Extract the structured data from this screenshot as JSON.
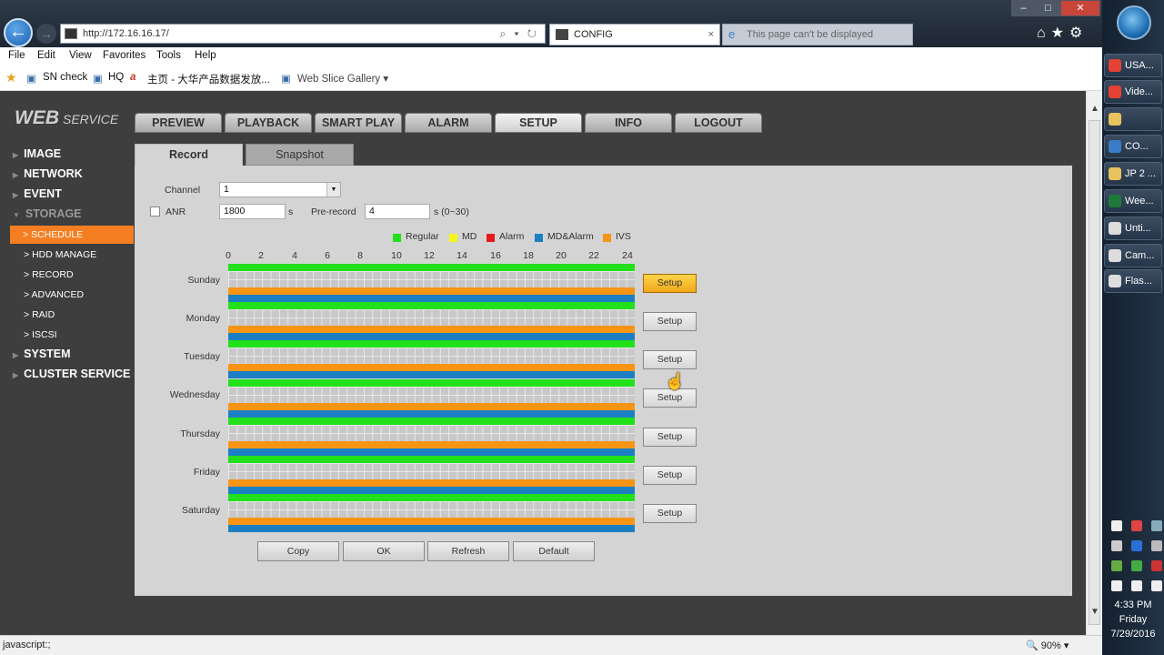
{
  "browser": {
    "url": "http://172.16.16.17/",
    "address_controls": "⌕ ▾ ↻",
    "tabs": [
      {
        "label": "CONFIG",
        "close": "×"
      },
      {
        "label": "This page can't be displayed"
      }
    ],
    "window_controls": {
      "minimize": "–",
      "maximize": "□",
      "close": "✕"
    },
    "menu": [
      "File",
      "Edit",
      "View",
      "Favorites",
      "Tools",
      "Help"
    ],
    "favorites": [
      "SN check",
      "HQ",
      "主页 - 大华产品数据发放...",
      "Web Slice Gallery ▾"
    ],
    "status_text": "javascript:;",
    "zoom": "🔍 90% ▾"
  },
  "app": {
    "logo_main": "WEB",
    "logo_sub": "SERVICE",
    "nav_tabs": [
      "PREVIEW",
      "PLAYBACK",
      "SMART PLAY",
      "ALARM",
      "SETUP",
      "INFO",
      "LOGOUT"
    ],
    "active_nav": "SETUP",
    "sidebar": {
      "items": [
        "IMAGE",
        "NETWORK",
        "EVENT",
        "STORAGE",
        "SYSTEM",
        "CLUSTER SERVICE"
      ],
      "storage_sub": [
        "SCHEDULE",
        "HDD MANAGE",
        "RECORD",
        "ADVANCED",
        "RAID",
        "ISCSI"
      ],
      "active_sub": "SCHEDULE"
    },
    "sub_tabs": [
      "Record",
      "Snapshot"
    ],
    "form": {
      "channel_label": "Channel",
      "channel_value": "1",
      "anr_label": "ANR",
      "anr_value": "1800",
      "anr_unit": "s",
      "prerecord_label": "Pre-record",
      "prerecord_value": "4",
      "prerecord_unit": "s (0~30)"
    },
    "legend": [
      {
        "label": "Regular",
        "color": "#22e01a"
      },
      {
        "label": "MD",
        "color": "#f5f51c"
      },
      {
        "label": "Alarm",
        "color": "#e31b1b"
      },
      {
        "label": "MD&Alarm",
        "color": "#1c7fc4"
      },
      {
        "label": "IVS",
        "color": "#f79414"
      }
    ],
    "hours": [
      "0",
      "2",
      "4",
      "6",
      "8",
      "10",
      "12",
      "14",
      "16",
      "18",
      "20",
      "22",
      "24"
    ],
    "days": [
      "Sunday",
      "Monday",
      "Tuesday",
      "Wednesday",
      "Thursday",
      "Friday",
      "Saturday"
    ],
    "setup_label": "Setup",
    "actions": [
      "Copy",
      "OK",
      "Refresh",
      "Default"
    ]
  },
  "taskbar": {
    "items": [
      "USA...",
      "Vide...",
      "",
      "CO...",
      "JP 2 ...",
      "Wee...",
      "Unti...",
      "Cam...",
      "Flas..."
    ],
    "time": "4:33 PM",
    "day": "Friday",
    "date": "7/29/2016"
  }
}
